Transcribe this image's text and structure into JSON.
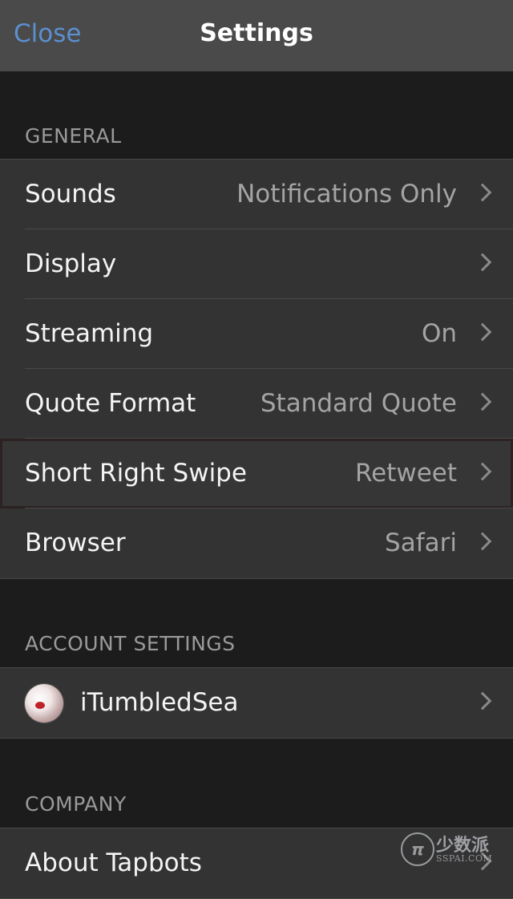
{
  "navbar": {
    "close_label": "Close",
    "title": "Settings"
  },
  "sections": {
    "general": {
      "header": "GENERAL",
      "rows": [
        {
          "label": "Sounds",
          "value": "Notifications Only"
        },
        {
          "label": "Display",
          "value": ""
        },
        {
          "label": "Streaming",
          "value": "On"
        },
        {
          "label": "Quote Format",
          "value": "Standard Quote"
        },
        {
          "label": "Short Right Swipe",
          "value": "Retweet"
        },
        {
          "label": "Browser",
          "value": "Safari"
        }
      ]
    },
    "account": {
      "header": "ACCOUNT SETTINGS",
      "rows": [
        {
          "label": "iTumbledSea"
        }
      ]
    },
    "company": {
      "header": "COMPANY",
      "rows": [
        {
          "label": "About Tapbots"
        }
      ]
    }
  },
  "watermark": {
    "logo": "π",
    "name_cn": "少数派",
    "name_en": "SSPAI.COM"
  },
  "icons": {
    "chevron": "chevron-right-icon",
    "avatar": "avatar"
  },
  "colors": {
    "accent": "#5b8fcf",
    "background": "#1c1c1c",
    "cell": "#333333"
  }
}
